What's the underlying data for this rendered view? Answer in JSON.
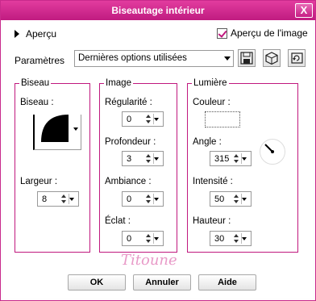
{
  "window": {
    "title": "Biseautage intérieur",
    "close_glyph": "X"
  },
  "preview": {
    "toggle_label": "Aperçu",
    "show_image_label": "Aperçu de l'image",
    "show_image_checked": true
  },
  "presets": {
    "label": "Paramètres",
    "selected": "Dernières options utilisées"
  },
  "groups": {
    "bevel": {
      "title": "Biseau",
      "shape_label": "Biseau :",
      "width_label": "Largeur :",
      "width_value": "8"
    },
    "image": {
      "title": "Image",
      "smoothness_label": "Régularité :",
      "smoothness_value": "0",
      "depth_label": "Profondeur :",
      "depth_value": "3",
      "ambience_label": "Ambiance :",
      "ambience_value": "0",
      "shine_label": "Éclat :",
      "shine_value": "0"
    },
    "light": {
      "title": "Lumière",
      "color_label": "Couleur :",
      "angle_label": "Angle :",
      "angle_value": "315",
      "intensity_label": "Intensité :",
      "intensity_value": "50",
      "elevation_label": "Hauteur :",
      "elevation_value": "30"
    }
  },
  "buttons": {
    "ok": "OK",
    "cancel": "Annuler",
    "help": "Aide"
  },
  "watermark": "Titoune",
  "colors": {
    "accent": "#c0187e",
    "titlebar": "#d3288f"
  },
  "icons": [
    "save-icon",
    "cube-icon",
    "reset-icon",
    "expand-triangle-icon",
    "checkmark-icon",
    "dropdown-arrow-icon"
  ]
}
